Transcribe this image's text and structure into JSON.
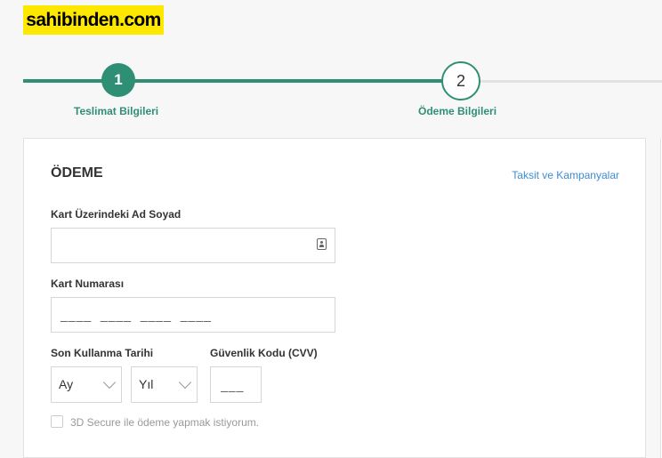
{
  "brand": {
    "logo_text": "sahibinden.com",
    "logo_color": "#ffe800"
  },
  "steps": [
    {
      "number": "1",
      "label": "Teslimat Bilgileri",
      "state": "completed"
    },
    {
      "number": "2",
      "label": "Ödeme Bilgileri",
      "state": "active"
    }
  ],
  "colors": {
    "accent": "#2f8f75",
    "link": "#3d8bd5"
  },
  "payment": {
    "title": "ÖDEME",
    "installments_link": "Taksit ve Kampanyalar",
    "cardholder_label": "Kart Üzerindeki Ad Soyad",
    "cardholder_value": "",
    "card_number_label": "Kart Numarası",
    "card_number_placeholder": "____  ____  ____  ____",
    "expiry_label": "Son Kullanma Tarihi",
    "month_value": "Ay",
    "year_value": "Yıl",
    "cvv_label": "Güvenlik Kodu (CVV)",
    "cvv_placeholder": "___",
    "secure_label": "3D Secure ile ödeme yapmak istiyorum.",
    "secure_checked": false
  }
}
